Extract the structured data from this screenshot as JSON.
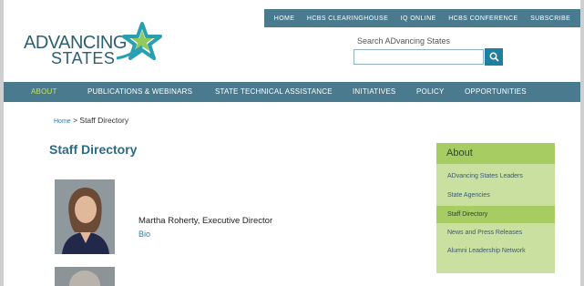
{
  "utility_nav": [
    "HOME",
    "HCBS CLEARINGHOUSE",
    "IQ ONLINE",
    "HCBS CONFERENCE",
    "SUBSCRIBE"
  ],
  "logo": {
    "line1": "ADVANCING",
    "line2": "STATES"
  },
  "search": {
    "label": "Search ADvancing States",
    "placeholder": ""
  },
  "main_nav": [
    "ABOUT",
    "PUBLICATIONS & WEBINARS",
    "STATE TECHNICAL ASSISTANCE",
    "INITIATIVES",
    "POLICY",
    "OPPORTUNITIES"
  ],
  "breadcrumb": {
    "home": "Home",
    "separator": ">",
    "current": "Staff Directory"
  },
  "page_title": "Staff Directory",
  "staff": [
    {
      "name": "Martha Roherty, Executive Director",
      "bio_link": "Bio"
    }
  ],
  "sidebar": {
    "title": "About",
    "links": [
      "ADvancing States Leaders",
      "State Agencies",
      "Staff Directory",
      "News and Press Releases",
      "Alumni Leadership Network"
    ],
    "active_link": "Staff Directory"
  },
  "colors": {
    "nav_bg": "#4a7a8e",
    "brand_blue": "#2d6a84",
    "sidebar_green": "#a6cc62",
    "sidebar_light": "#c9e0a0",
    "active_nav": "#c8e36a"
  }
}
